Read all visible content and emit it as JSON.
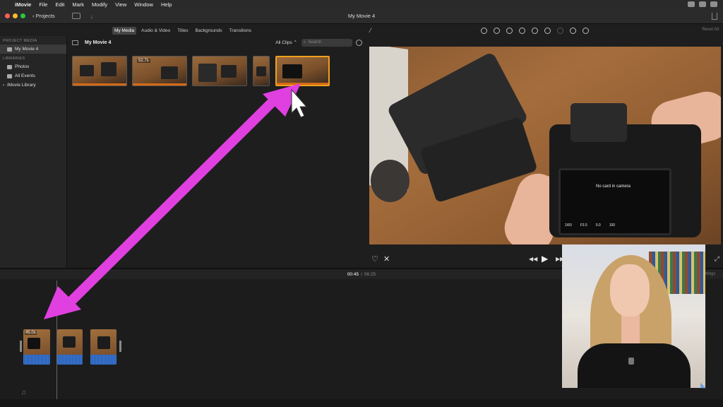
{
  "menubar": {
    "apple": "",
    "app": "iMovie",
    "items": [
      "File",
      "Edit",
      "Mark",
      "Modify",
      "View",
      "Window",
      "Help"
    ]
  },
  "window": {
    "title": "My Movie 4",
    "projects_label": "Projects"
  },
  "media_tabs": [
    "My Media",
    "Audio & Video",
    "Titles",
    "Backgrounds",
    "Transitions"
  ],
  "viewer_toolbar": {
    "reset_label": "Reset All",
    "icons": [
      "color-balance-icon",
      "color-correction-icon",
      "crop-icon",
      "stabilization-icon",
      "volume-icon",
      "noise-reduction-icon",
      "speed-icon",
      "clip-filter-icon",
      "info-icon"
    ]
  },
  "sidebar": {
    "section_project": "PROJECT MEDIA",
    "project_item": "My Movie 4",
    "section_libraries": "LIBRARIES",
    "library_items": [
      "Photos",
      "All Events",
      "iMovie Library"
    ]
  },
  "browser": {
    "event_name": "My Movie 4",
    "clips_filter": "All Clips",
    "search_placeholder": "Search",
    "thumb_badge": "52.7s"
  },
  "viewer": {
    "camera_text": "No card in camera",
    "camera_values": [
      "1/60",
      "F3.5",
      "0.0",
      "100"
    ]
  },
  "timeline": {
    "current_time": "00:45",
    "separator": "/",
    "total_time": "06:25",
    "clip_badge": "45.0s",
    "settings_label": "ttings"
  },
  "colors": {
    "accent_selection": "#f0a020",
    "annotation_arrow": "#e040e0",
    "audio_wave": "#3a7ad8"
  }
}
